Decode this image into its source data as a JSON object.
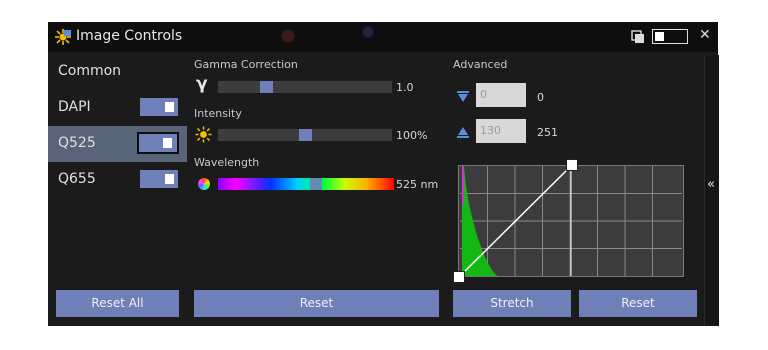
{
  "window": {
    "title": "Image Controls"
  },
  "sidebar": {
    "heading": "Common",
    "channels": [
      {
        "label": "DAPI",
        "enabled": true,
        "selected": false
      },
      {
        "label": "Q525",
        "enabled": true,
        "selected": true
      },
      {
        "label": "Q655",
        "enabled": true,
        "selected": false
      }
    ],
    "reset_all_label": "Reset All"
  },
  "gamma": {
    "label": "Gamma Correction",
    "symbol": "γ",
    "value": "1.0",
    "level": 0.26
  },
  "intensity": {
    "label": "Intensity",
    "value": "100%",
    "level": 0.5
  },
  "wavelength": {
    "label": "Wavelength",
    "value": "525 nm",
    "level": 0.56
  },
  "reset_label": "Reset",
  "advanced": {
    "label": "Advanced",
    "min_input": "0",
    "min_value": "0",
    "max_input": "130",
    "max_value": "251",
    "stretch_label": "Stretch",
    "reset_label": "Reset"
  },
  "colors": {
    "accent": "#6f7fb8",
    "window_bg": "#1b1b1b",
    "histogram_fill": "#14b814"
  },
  "icons": [
    "app-icon",
    "float-window-icon",
    "close-icon",
    "gamma-icon",
    "brightness-icon",
    "color-wheel-icon",
    "black-point-icon",
    "white-point-icon",
    "collapse-icon"
  ]
}
